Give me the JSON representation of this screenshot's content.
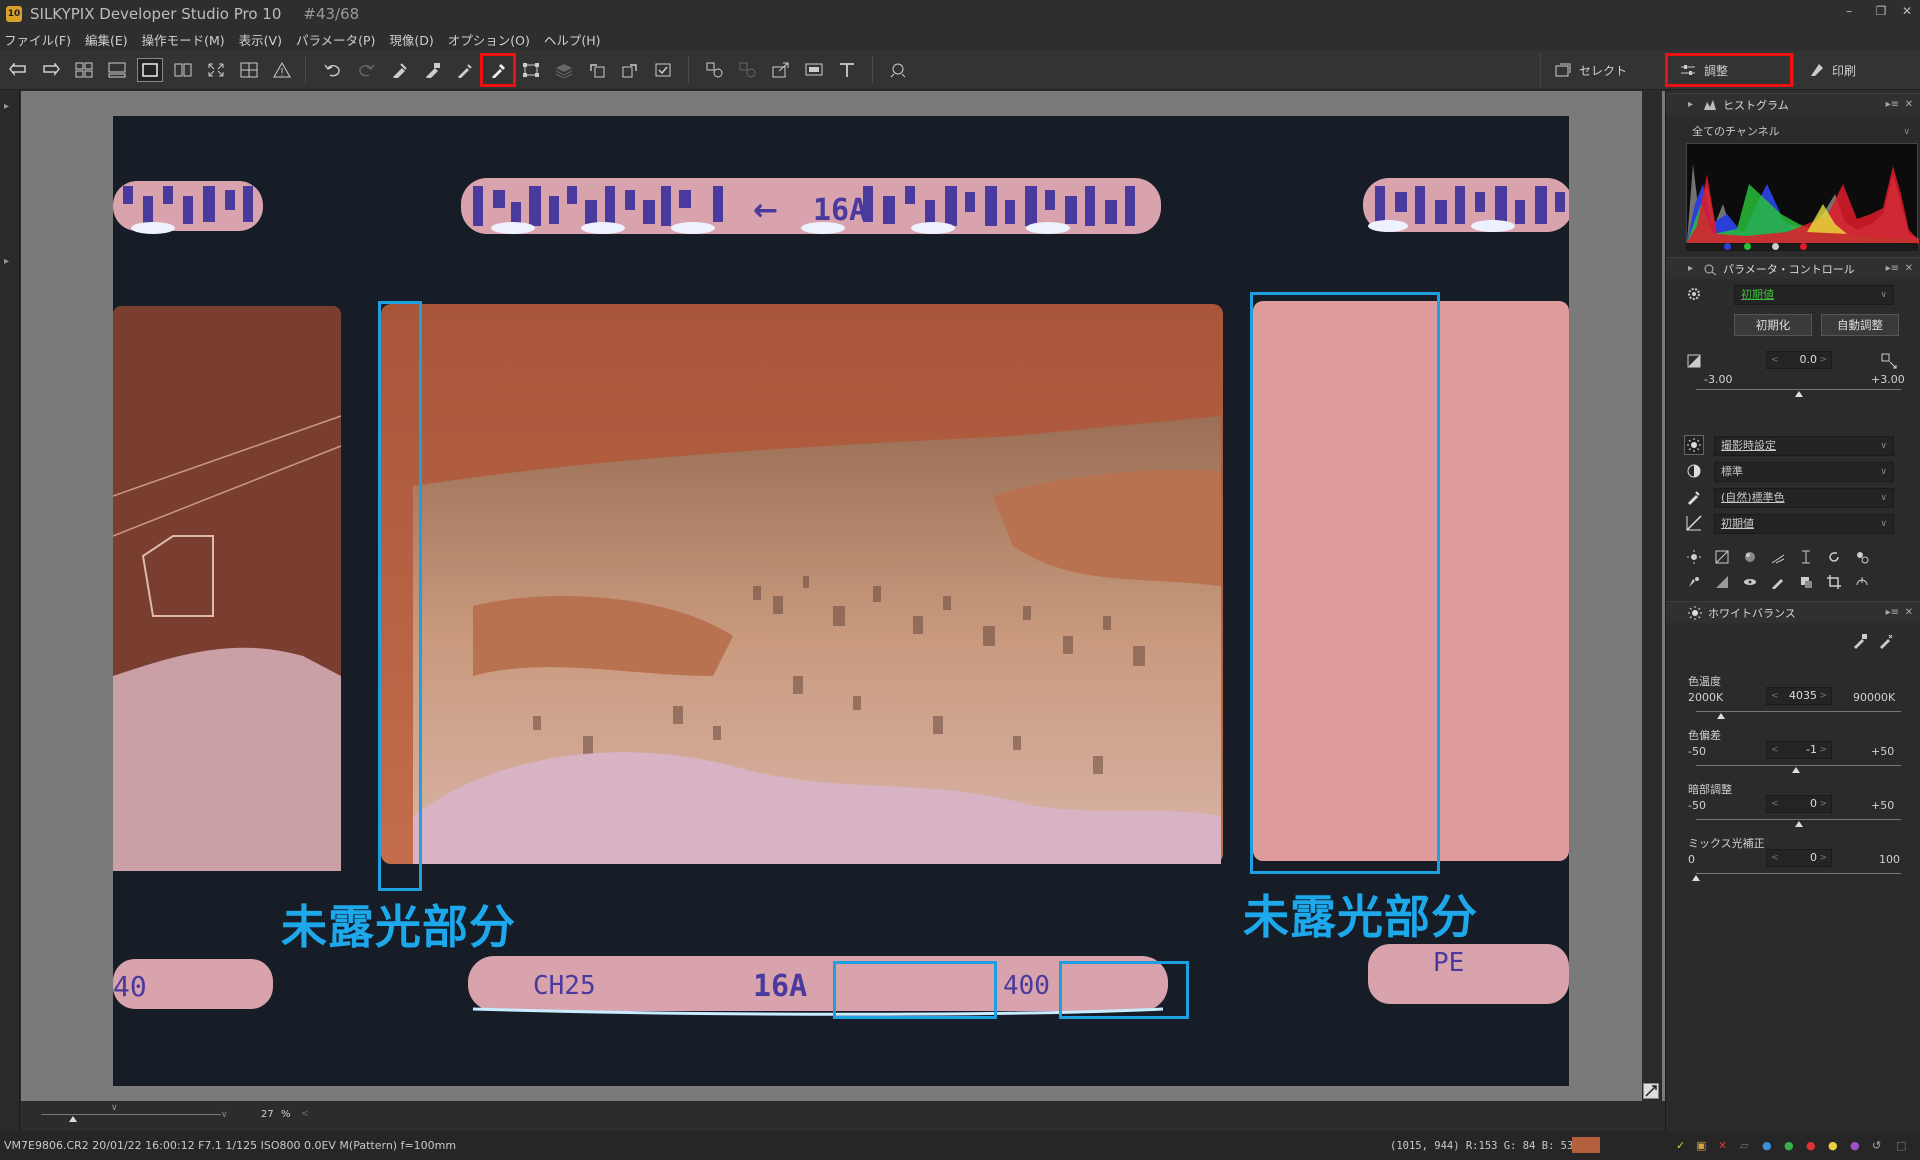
{
  "window": {
    "title": "SILKYPIX Developer Studio Pro 10",
    "image_counter": "#43/68",
    "app_badge": "10",
    "min_icon": "minimize-icon",
    "max_icon": "restore-icon",
    "close_icon": "close-icon"
  },
  "menu": [
    "ファイル(F)",
    "編集(E)",
    "操作モード(M)",
    "表示(V)",
    "パラメータ(P)",
    "現像(D)",
    "オプション(O)",
    "ヘルプ(H)"
  ],
  "mode_tabs": {
    "select": "セレクト",
    "adjust": "調整",
    "print": "印刷"
  },
  "annotations": {
    "unexposed_left": "未露光部分",
    "unexposed_right": "未露光部分"
  },
  "film": {
    "edge_top": "16A",
    "edge_bottom_1": "CH25",
    "edge_bottom_2": "16A",
    "edge_bottom_3": "400",
    "edge_bottom_left": "40",
    "edge_bottom_right": "PE"
  },
  "viewer": {
    "zoom_value": "27",
    "zoom_unit": "%"
  },
  "status": {
    "file_info": "VM7E9806.CR2 20/01/22 16:00:12 F7.1 1/125 ISO800  0.0EV M(Pattern) f=100mm",
    "pixel_info": "(1015, 944) R:153 G: 84 B: 53",
    "pixel_color": "#b5603c"
  },
  "histogram": {
    "title": "ヒストグラム",
    "channel": "全てのチャンネル"
  },
  "param_control": {
    "title": "パラメータ・コントロール",
    "preset": "初期値",
    "reset_button": "初期化",
    "auto_button": "自動調整",
    "exposure": {
      "value": "0.0",
      "min": "-3.00",
      "max": "+3.00",
      "level": 0.5
    },
    "dropdowns": [
      "撮影時設定",
      "標準",
      "(自然)標準色",
      "初期値"
    ]
  },
  "white_balance": {
    "title": "ホワイトバランス",
    "sliders": [
      {
        "label": "色温度",
        "min": "2000K",
        "max": "90000K",
        "value": "4035",
        "level": 0.12
      },
      {
        "label": "色偏差",
        "min": "-50",
        "max": "+50",
        "value": "-1",
        "level": 0.49
      },
      {
        "label": "暗部調整",
        "min": "-50",
        "max": "+50",
        "value": "0",
        "level": 0.5
      },
      {
        "label": "ミックス光補正",
        "min": "0",
        "max": "100",
        "value": "0",
        "level": 0.0
      }
    ]
  },
  "colors": {
    "highlight_red": "#e11111",
    "annotation_blue": "#1ea8ec",
    "preset_green": "#3fbf3f"
  }
}
